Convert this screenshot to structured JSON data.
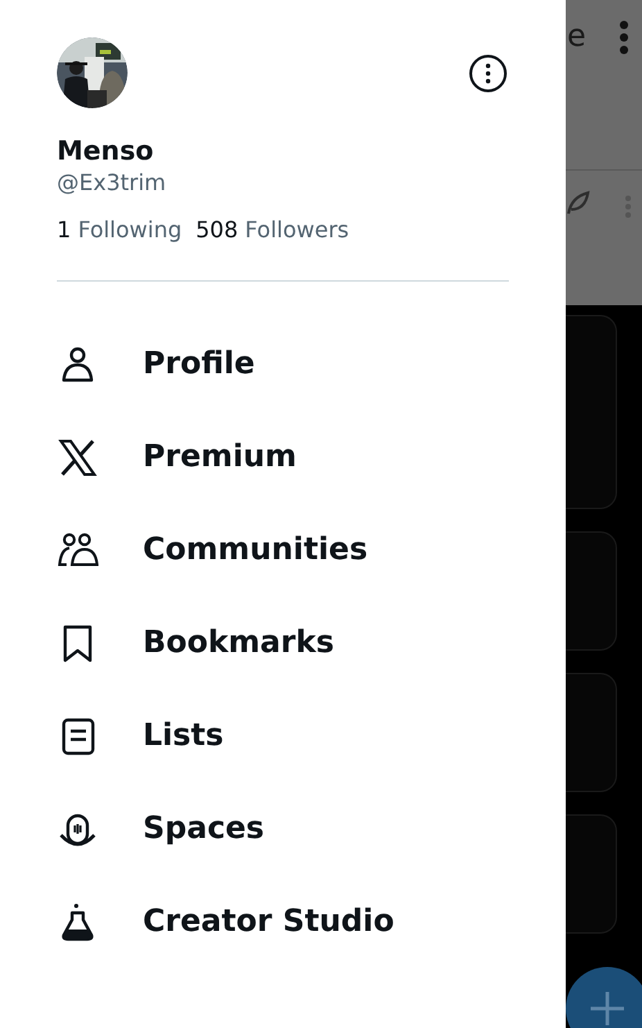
{
  "account": {
    "name": "Menso",
    "handle": "@Ex3trim",
    "following_count": "1",
    "following_label": "Following",
    "followers_count": "508",
    "followers_label": "Followers"
  },
  "menu": [
    {
      "label": "Profile",
      "kind": "profile"
    },
    {
      "label": "Premium",
      "kind": "premium"
    },
    {
      "label": "Communities",
      "kind": "communities"
    },
    {
      "label": "Bookmarks",
      "kind": "bookmarks"
    },
    {
      "label": "Lists",
      "kind": "lists"
    },
    {
      "label": "Spaces",
      "kind": "spaces"
    },
    {
      "label": "Creator Studio",
      "kind": "creator_studio"
    }
  ],
  "background": {
    "header_fragment": "e"
  }
}
